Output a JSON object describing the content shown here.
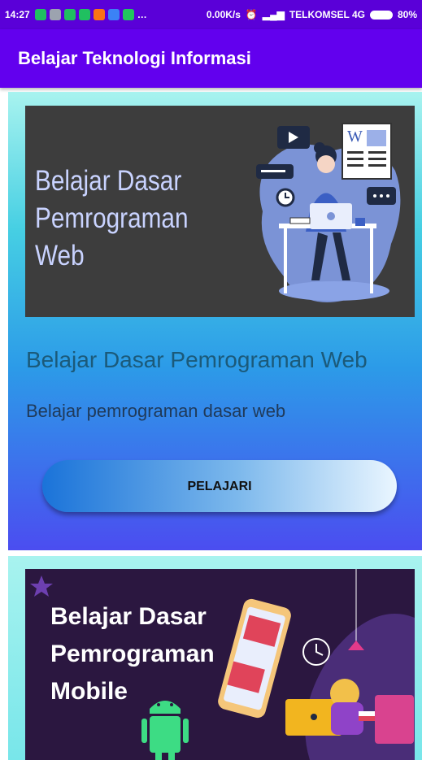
{
  "status_bar": {
    "time": "14:27",
    "speed": "0.00K/s",
    "carrier": "TELKOMSEL 4G",
    "battery": "80%"
  },
  "app_bar": {
    "title": "Belajar Teknologi Informasi"
  },
  "cards": [
    {
      "banner_text_line1": "Belajar Dasar",
      "banner_text_line2": "Pemrograman Web",
      "title": "Belajar Dasar Pemrograman Web",
      "description": "Belajar pemrograman dasar web",
      "button_label": "PELAJARI"
    },
    {
      "banner_text_line1": "Belajar Dasar",
      "banner_text_line2": "Pemrograman",
      "banner_text_line3": "Mobile"
    }
  ],
  "colors": {
    "status_bar": "#5a00d8",
    "app_bar": "#6200ee",
    "android_green": "#3ddc84"
  }
}
